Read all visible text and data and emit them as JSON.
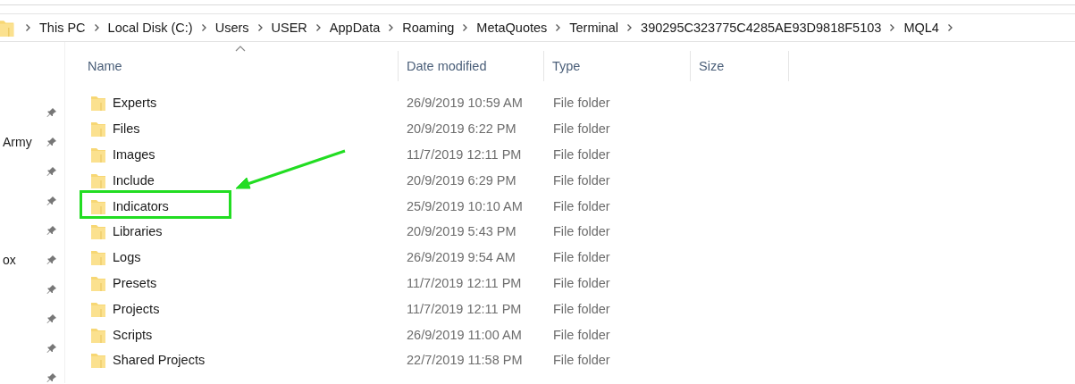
{
  "breadcrumb": [
    "This PC",
    "Local Disk (C:)",
    "Users",
    "USER",
    "AppData",
    "Roaming",
    "MetaQuotes",
    "Terminal",
    "390295C323775C4285AE93D9818F5103",
    "MQL4"
  ],
  "sidebar": {
    "items": [
      {
        "pinned": true
      },
      {
        "label": "Army",
        "pinned": true
      },
      {
        "pinned": true
      },
      {
        "pinned": true
      },
      {
        "pinned": true
      },
      {
        "label": "ox",
        "pinned": true
      },
      {
        "pinned": true
      },
      {
        "pinned": true
      },
      {
        "pinned": true
      },
      {
        "pinned": true
      }
    ]
  },
  "table": {
    "columns": [
      {
        "label": "Name",
        "sorted": true
      },
      {
        "label": "Date modified",
        "sorted": false
      },
      {
        "label": "Type",
        "sorted": false
      },
      {
        "label": "Size",
        "sorted": false
      }
    ],
    "rows": [
      {
        "name": "Experts",
        "date": "26/9/2019 10:59 AM",
        "type": "File folder",
        "highlighted": false
      },
      {
        "name": "Files",
        "date": "20/9/2019 6:22 PM",
        "type": "File folder",
        "highlighted": false
      },
      {
        "name": "Images",
        "date": "11/7/2019 12:11 PM",
        "type": "File folder",
        "highlighted": false
      },
      {
        "name": "Include",
        "date": "20/9/2019 6:29 PM",
        "type": "File folder",
        "highlighted": false
      },
      {
        "name": "Indicators",
        "date": "25/9/2019 10:10 AM",
        "type": "File folder",
        "highlighted": true
      },
      {
        "name": "Libraries",
        "date": "20/9/2019 5:43 PM",
        "type": "File folder",
        "highlighted": false
      },
      {
        "name": "Logs",
        "date": "26/9/2019 9:54 AM",
        "type": "File folder",
        "highlighted": false
      },
      {
        "name": "Presets",
        "date": "11/7/2019 12:11 PM",
        "type": "File folder",
        "highlighted": false
      },
      {
        "name": "Projects",
        "date": "11/7/2019 12:11 PM",
        "type": "File folder",
        "highlighted": false
      },
      {
        "name": "Scripts",
        "date": "26/9/2019 11:00 AM",
        "type": "File folder",
        "highlighted": false
      },
      {
        "name": "Shared Projects",
        "date": "22/7/2019 11:58 PM",
        "type": "File folder",
        "highlighted": false
      }
    ]
  }
}
